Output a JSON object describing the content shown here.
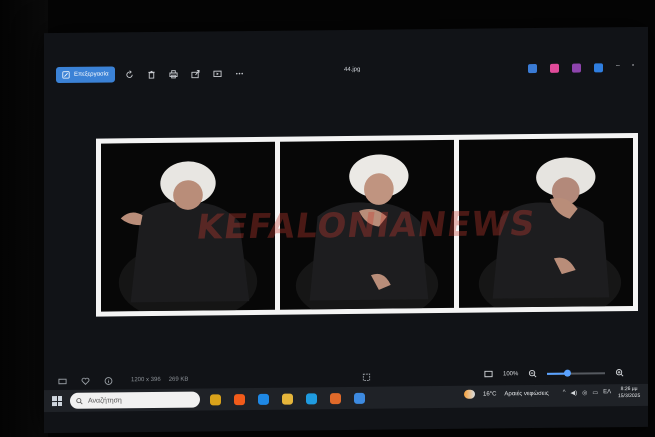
{
  "toolbar": {
    "edit_label": "Επεξεργασία",
    "filename": "44.jpg",
    "icons": [
      "edit-icon",
      "rotate-icon",
      "delete-icon",
      "print-icon",
      "share-icon",
      "slideshow-icon",
      "more-icon"
    ]
  },
  "apps": {
    "colors": [
      "#3a7bd5",
      "#e04b9a",
      "#8e44ad",
      "#2f7ee0"
    ]
  },
  "window_controls": {
    "minimize": "–",
    "maximize": "▫"
  },
  "image": {
    "watermark": "KEFALONIANEWS"
  },
  "viewer_bottom": {
    "dimensions": "1200 x 396",
    "size": "269 KB",
    "zoom": "100%",
    "zoom_level": 0.35
  },
  "taskbar": {
    "search_placeholder": "Αναζήτηση",
    "app_colors": [
      "#d9a21a",
      "#f25b1a",
      "#1e88e5",
      "#e5b53b",
      "#1f9be0",
      "#e06a2a",
      "#3d8ae0"
    ],
    "weather_temp": "16°C",
    "weather_text": "Αραιές νεφώσεις",
    "language": "ΕΛ",
    "time": "8:26 μμ",
    "date": "15/3/2025"
  }
}
